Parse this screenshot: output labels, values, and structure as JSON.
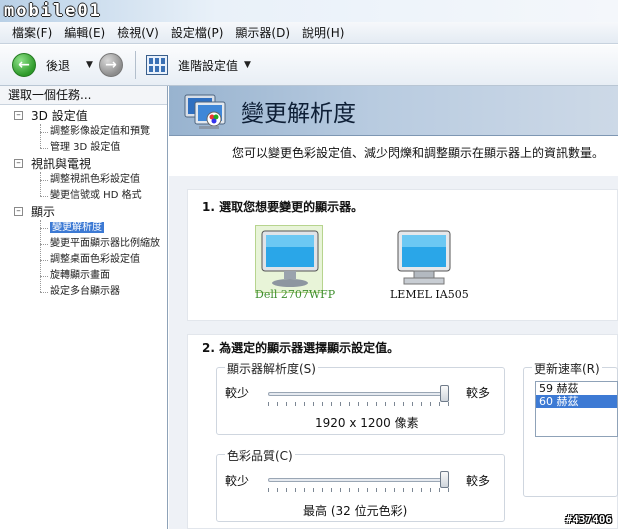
{
  "logo": "mobile01",
  "menu": [
    "檔案(F)",
    "編輯(E)",
    "檢視(V)",
    "設定檔(P)",
    "顯示器(D)",
    "說明(H)"
  ],
  "toolbar": {
    "back_label": "後退",
    "advanced_label": "進階設定值"
  },
  "left_panel": {
    "heading": "選取一個任務...",
    "categories": [
      {
        "label": "3D 設定值",
        "items": [
          "調整影像設定值和預覽",
          "管理 3D 設定值"
        ]
      },
      {
        "label": "視訊與電視",
        "items": [
          "調整視訊色彩設定值",
          "變更信號或 HD 格式"
        ]
      },
      {
        "label": "顯示",
        "items": [
          "變更解析度",
          "變更平面顯示器比例縮放",
          "調整桌面色彩設定值",
          "旋轉顯示畫面",
          "設定多台顯示器"
        ]
      }
    ],
    "selected_item": "變更解析度"
  },
  "page": {
    "title": "變更解析度",
    "intro": "您可以變更色彩設定值、減少閃爍和調整顯示在顯示器上的資訊數量。"
  },
  "section1": {
    "title": "1. 選取您想要變更的顯示器。",
    "monitors": [
      "Dell 2707WFP",
      "LEMEL IA505"
    ],
    "selected_monitor": "Dell 2707WFP"
  },
  "section2": {
    "title": "2. 為選定的顯示器選擇顯示設定值。",
    "resolution": {
      "label": "顯示器解析度(S)",
      "less": "較少",
      "more": "較多",
      "value": "1920 x 1200 像素",
      "slider_position": 1.0
    },
    "color_quality": {
      "label": "色彩品質(C)",
      "less": "較少",
      "more": "較多",
      "value": "最高 (32 位元色彩)",
      "slider_position": 1.0
    },
    "refresh": {
      "label": "更新速率(R)",
      "options": [
        "59 赫茲",
        "60 赫茲"
      ],
      "selected": "60 赫茲"
    }
  },
  "watermark": "#437406",
  "colors": {
    "accent": "#3d7ad4",
    "header": "#b8cbe0",
    "selected_monitor_bg": "#e8f4d8"
  }
}
